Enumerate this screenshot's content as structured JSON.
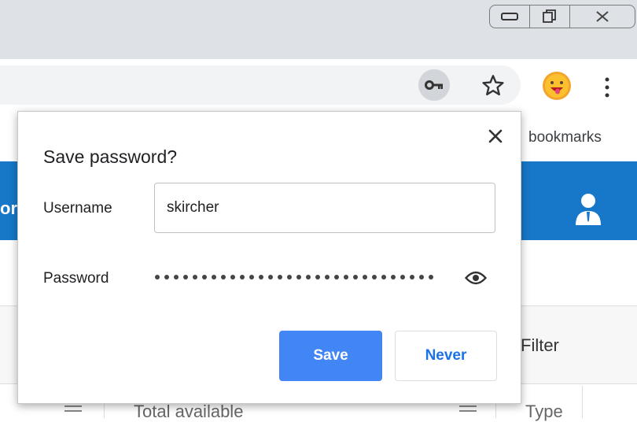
{
  "window": {
    "minimize_icon": "minimize-icon",
    "restore_icon": "restore-icon",
    "close_icon": "window-close-icon"
  },
  "toolbar": {
    "key_icon": "key-icon",
    "star_icon": "star-icon",
    "avatar_icon": "emoji-avatar-icon",
    "menu_icon": "kebab-menu-icon"
  },
  "bookmarks_bar": {
    "label": "bookmarks"
  },
  "page": {
    "header_text_fragment": "or",
    "header_user_icon": "user-icon",
    "filter_label": "Filter",
    "table_col_total": "Total available",
    "table_col_type": "Type"
  },
  "dialog": {
    "title": "Save password?",
    "close_icon": "close-icon",
    "username_label": "Username",
    "username_value": "skircher",
    "password_label": "Password",
    "password_mask": "••••••••••••••••••••••••••••••",
    "eye_icon": "eye-icon",
    "save_label": "Save",
    "never_label": "Never"
  },
  "colors": {
    "accent_blue": "#4285f4",
    "link_blue": "#1a73e8",
    "header_blue": "#1777c8",
    "titlebar_gray": "#dee1e6"
  }
}
